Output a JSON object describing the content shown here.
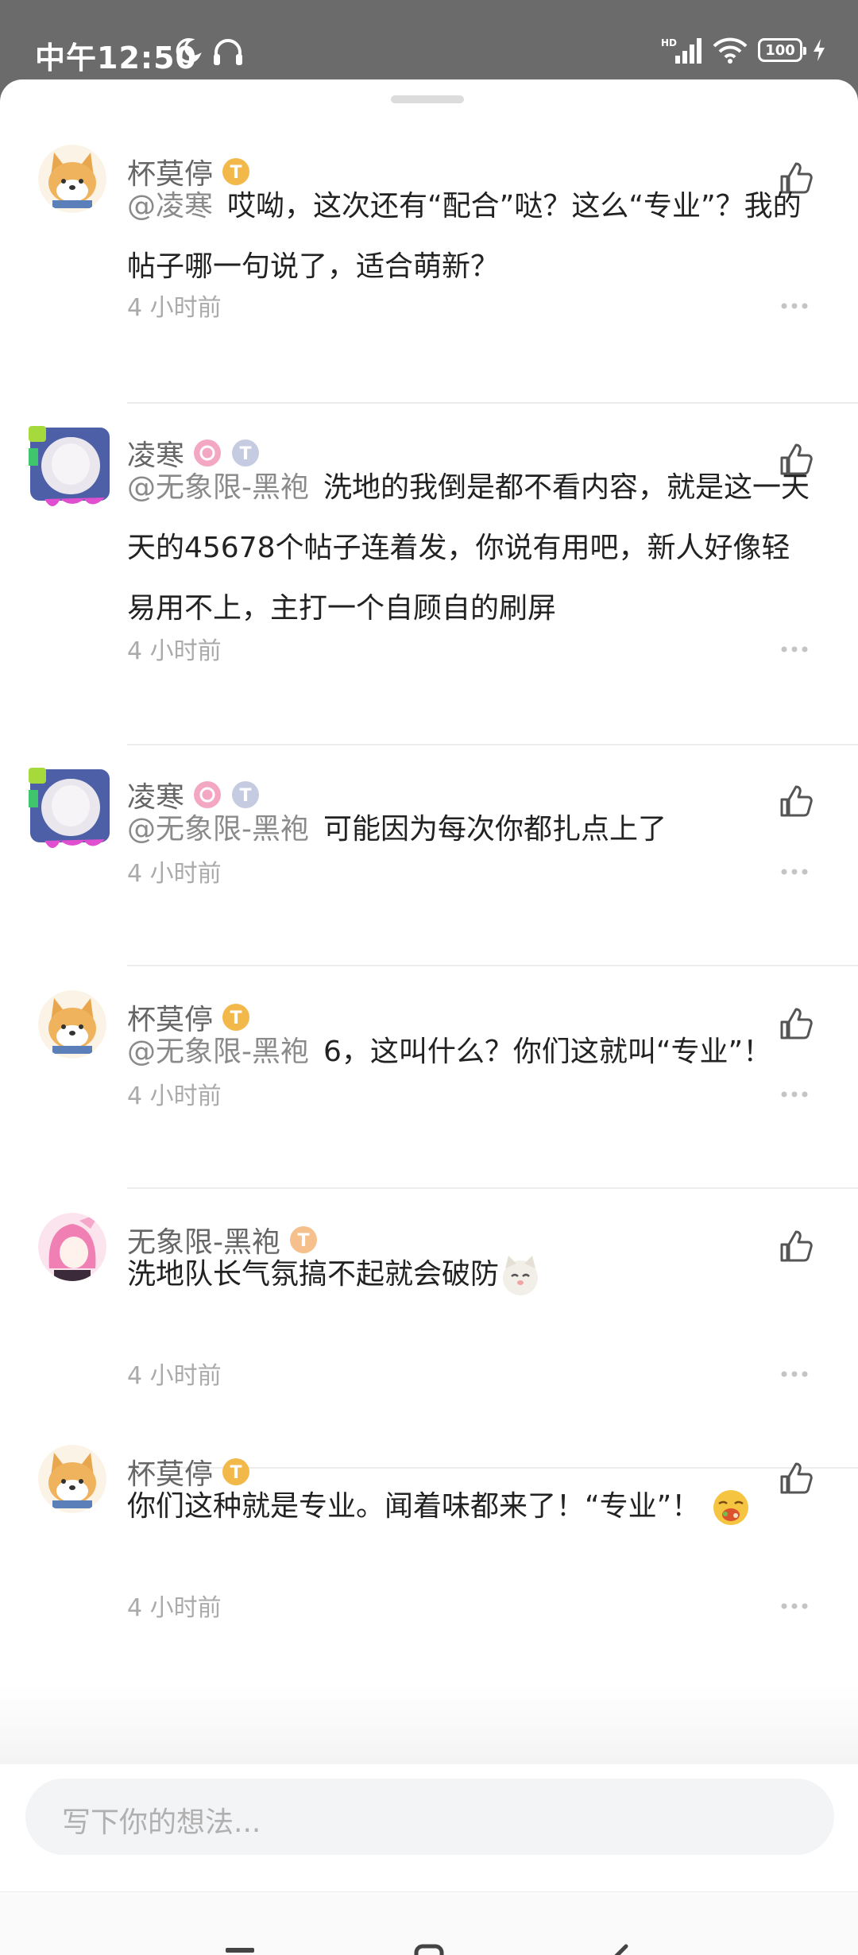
{
  "status_bar": {
    "time": "中午12:50",
    "battery": "100"
  },
  "comments": [
    {
      "user": "杯莫停",
      "level": "1",
      "mention": "@凌寒",
      "text": "哎呦，这次还有“配合”哒？这么“专业”？我的帖子哪一句说了，适合萌新？",
      "time": "4 小时前"
    },
    {
      "user": "凌寒",
      "level": "2",
      "mention": "@无象限-黑袍",
      "text": "洗地的我倒是都不看内容，就是这一天天的45678个帖子连着发，你说有用吧，新人好像轻易用不上，主打一个自顾自的刷屏",
      "time": "4 小时前"
    },
    {
      "user": "凌寒",
      "level": "2",
      "mention": "@无象限-黑袍",
      "text": "可能因为每次你都扎点上了",
      "time": "4 小时前"
    },
    {
      "user": "杯莫停",
      "level": "1",
      "mention": "@无象限-黑袍",
      "text": "6，这叫什么？你们这就叫“专业”！",
      "time": "4 小时前"
    },
    {
      "user": "无象限-黑袍",
      "level": "5",
      "mention": "",
      "text": "洗地队长气氛搞不起就会破防",
      "time": "4 小时前"
    },
    {
      "user": "杯莫停",
      "level": "1",
      "mention": "",
      "text": "你们这种就是专业。闻着味都来了！“专业”！",
      "time": "4 小时前"
    }
  ],
  "input": {
    "placeholder": "写下你的想法..."
  },
  "colors": {
    "gold_badge": "#f3b84a",
    "peach_badge": "#f5c08c",
    "silver_badge": "#c5cbe0",
    "pink_badge": "#f4a7c3"
  }
}
